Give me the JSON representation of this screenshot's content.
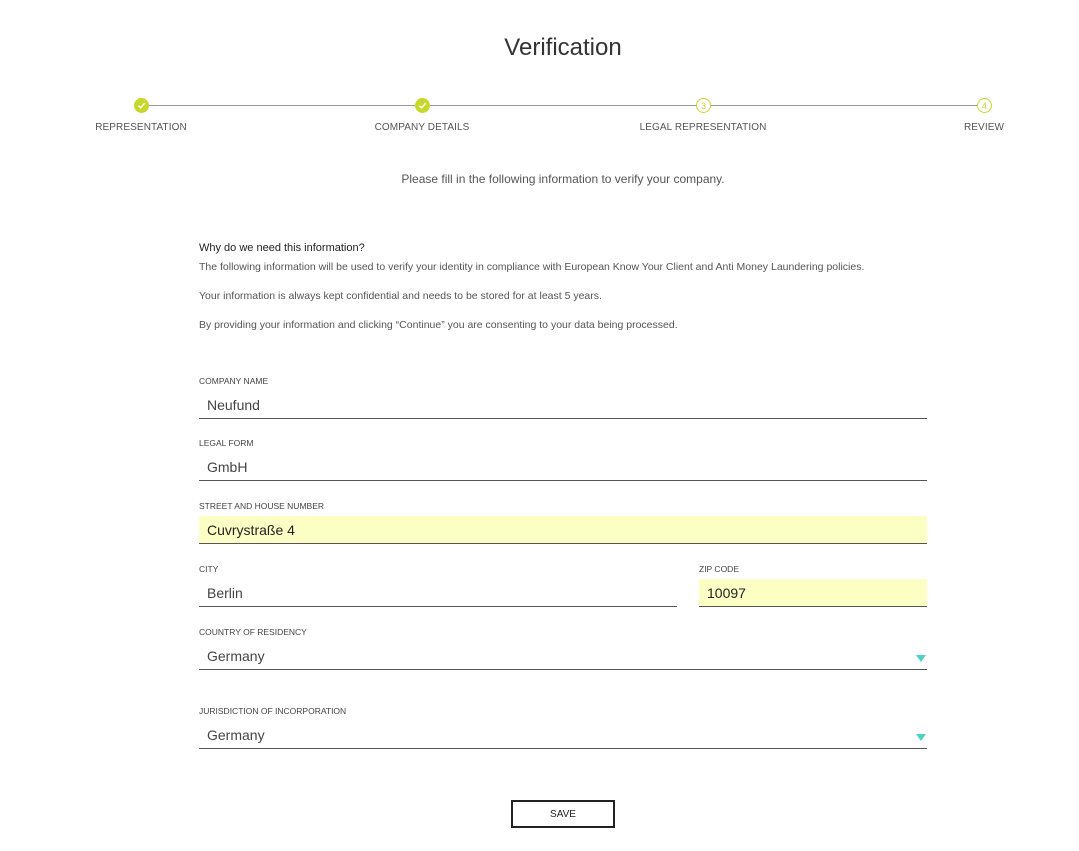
{
  "page": {
    "title": "Verification"
  },
  "stepper": {
    "steps": [
      {
        "label": "REPRESENTATION",
        "state": "done",
        "number": "1"
      },
      {
        "label": "COMPANY DETAILS",
        "state": "done",
        "number": "2"
      },
      {
        "label": "LEGAL REPRESENTATION",
        "state": "todo",
        "number": "3"
      },
      {
        "label": "REVIEW",
        "state": "todo",
        "number": "4"
      }
    ],
    "accent_color": "#c6d82a"
  },
  "intro": "Please fill in the following information to verify your company.",
  "why": {
    "title": "Why do we need this information?",
    "paragraphs": [
      "The following information will be used to verify your identity in compliance with European Know Your Client and Anti Money Laundering policies.",
      "Your information is always kept confidential and needs to be stored for at least 5 years.",
      "By providing your information and clicking “Continue” you are consenting to your data being processed."
    ]
  },
  "form": {
    "company_name": {
      "label": "COMPANY NAME",
      "value": "Neufund"
    },
    "legal_form": {
      "label": "LEGAL FORM",
      "value": "GmbH"
    },
    "street": {
      "label": "STREET AND HOUSE NUMBER",
      "value": "Cuvrystraße 4"
    },
    "city": {
      "label": "CITY",
      "value": "Berlin"
    },
    "zip": {
      "label": "ZIP CODE",
      "value": "10097"
    },
    "country": {
      "label": "COUNTRY OF RESIDENCY",
      "value": "Germany"
    },
    "jurisdiction": {
      "label": "JURISDICTION OF INCORPORATION",
      "value": "Germany"
    }
  },
  "save_label": "SAVE",
  "colors": {
    "autofill": "#fbffc4",
    "caret": "#4dd3c4"
  },
  "icons": {
    "step_done": "check-icon",
    "dropdown": "caret-down-icon"
  }
}
